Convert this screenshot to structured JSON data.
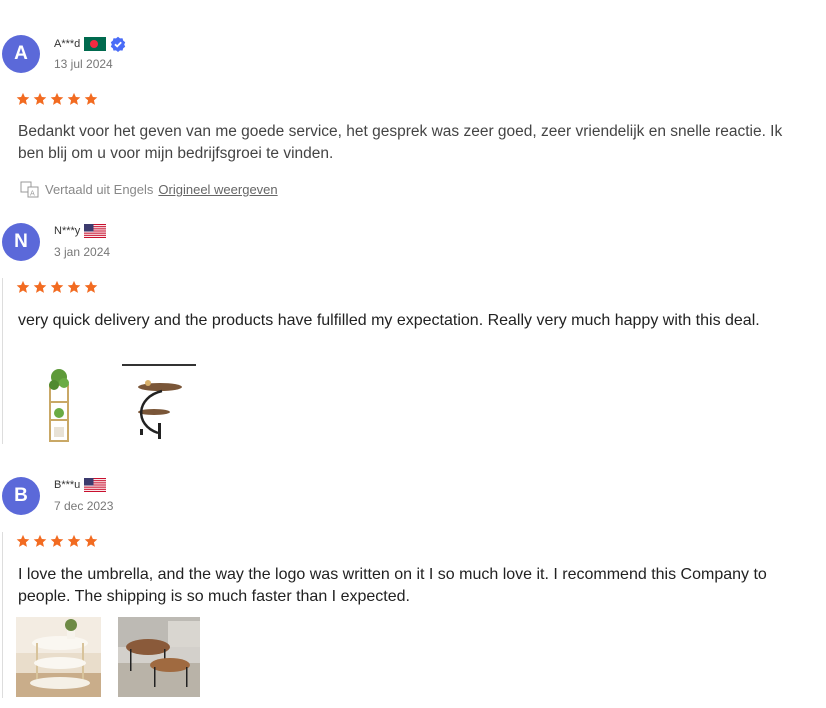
{
  "reviews": [
    {
      "avatar_letter": "A",
      "name": "A***d",
      "flag": "bangladesh",
      "verified_icon": "verified-badge-icon",
      "date": "13 jul 2024",
      "rating": 5,
      "text": "Bedankt voor het geven van me goede service, het gesprek was zeer goed, zeer vriendelijk en snelle reactie. Ik ben blij om u voor mijn bedrijfsgroei te vinden.",
      "translated_label": "Vertaald uit Engels",
      "show_original_label": "Origineel weergeven"
    },
    {
      "avatar_letter": "N",
      "name": "N***y",
      "flag": "usa",
      "date": "3 jan 2024",
      "rating": 5,
      "text": "very quick delivery and the products have fulfilled my expectation. Really very much happy with this deal.",
      "photos": [
        "plant-stand-photo",
        "round-side-table-photo"
      ]
    },
    {
      "avatar_letter": "B",
      "name": "B***u",
      "flag": "usa",
      "date": "7 dec 2023",
      "rating": 5,
      "text": "I love the umbrella, and the way the logo was written on it I so much love it. I recommend this Company to people. The shipping is so much faster than I expected.",
      "photos": [
        "white-cloud-table-photo",
        "nesting-tables-photo"
      ]
    }
  ],
  "colors": {
    "star": "#f26b21",
    "avatar": "#5b69d9",
    "verified": "#4a6cf7"
  }
}
